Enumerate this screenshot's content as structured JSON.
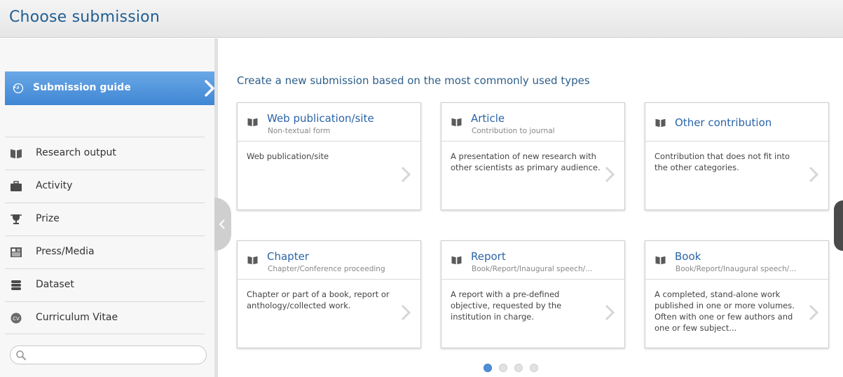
{
  "header": {
    "title": "Choose submission"
  },
  "sidebar": {
    "guide_label": "Submission guide",
    "items": [
      {
        "label": "Research output",
        "icon": "book-icon"
      },
      {
        "label": "Activity",
        "icon": "briefcase-icon"
      },
      {
        "label": "Prize",
        "icon": "trophy-icon"
      },
      {
        "label": "Press/Media",
        "icon": "newspaper-icon"
      },
      {
        "label": "Dataset",
        "icon": "database-icon"
      },
      {
        "label": "Curriculum Vitae",
        "icon": "cv-icon"
      }
    ],
    "search": {
      "placeholder": "",
      "value": ""
    }
  },
  "main": {
    "title": "Create a new submission based on the most commonly used types",
    "cards": [
      {
        "title": "Web publication/site",
        "subtitle": "Non-textual form",
        "description": "Web publication/site"
      },
      {
        "title": "Article",
        "subtitle": "Contribution to journal",
        "description": "A presentation of new research with other scientists as primary audience."
      },
      {
        "title": "Other contribution",
        "subtitle": "",
        "description": "Contribution that does not fit into the other categories."
      },
      {
        "title": "Chapter",
        "subtitle": "Chapter/Conference proceeding",
        "description": "Chapter or part of a book, report or anthology/collected work."
      },
      {
        "title": "Report",
        "subtitle": "Book/Report/Inaugural speech/...",
        "description": "A report with a pre-defined objective, requested by the institution in charge."
      },
      {
        "title": "Book",
        "subtitle": "Book/Report/Inaugural speech/...",
        "description": "A completed, stand-alone work published in one or more volumes. Often with one or few authors and one or few subject..."
      }
    ],
    "pagination": {
      "total_pages": 4,
      "current_page": 1
    }
  },
  "colors": {
    "accent": "#3f86d4",
    "title_blue": "#1f5e93",
    "link_blue": "#2a64a8"
  }
}
